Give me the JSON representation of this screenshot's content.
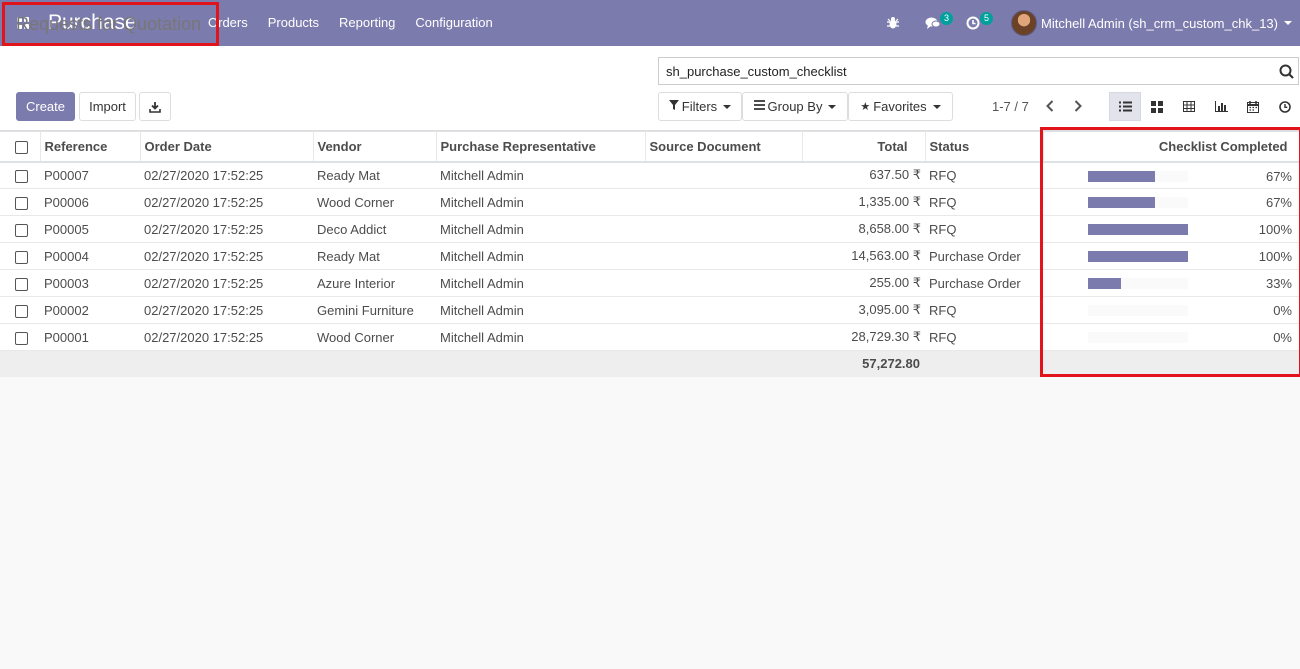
{
  "app": {
    "title": "Purchase"
  },
  "menu": [
    "Orders",
    "Products",
    "Reporting",
    "Configuration"
  ],
  "nav": {
    "messages_count": "3",
    "activities_count": "5",
    "user_name": "Mitchell Admin (sh_crm_custom_chk_13)"
  },
  "page": {
    "title": "Requests for Quotation"
  },
  "buttons": {
    "create": "Create",
    "import": "Import"
  },
  "search": {
    "value": "sh_purchase_custom_checklist"
  },
  "filters": {
    "filters": "Filters",
    "group_by": "Group By",
    "favorites": "Favorites"
  },
  "pager": {
    "text": "1-7 / 7"
  },
  "table": {
    "columns": [
      "Reference",
      "Order Date",
      "Vendor",
      "Purchase Representative",
      "Source Document",
      "Total",
      "Status",
      "Checklist Completed"
    ],
    "rows": [
      {
        "reference": "P00007",
        "order_date": "02/27/2020 17:52:25",
        "vendor": "Ready Mat",
        "rep": "Mitchell Admin",
        "source": "",
        "total": "637.50 ₹",
        "status": "RFQ",
        "checklist": 67,
        "checklist_label": "67%"
      },
      {
        "reference": "P00006",
        "order_date": "02/27/2020 17:52:25",
        "vendor": "Wood Corner",
        "rep": "Mitchell Admin",
        "source": "",
        "total": "1,335.00 ₹",
        "status": "RFQ",
        "checklist": 67,
        "checklist_label": "67%"
      },
      {
        "reference": "P00005",
        "order_date": "02/27/2020 17:52:25",
        "vendor": "Deco Addict",
        "rep": "Mitchell Admin",
        "source": "",
        "total": "8,658.00 ₹",
        "status": "RFQ",
        "checklist": 100,
        "checklist_label": "100%"
      },
      {
        "reference": "P00004",
        "order_date": "02/27/2020 17:52:25",
        "vendor": "Ready Mat",
        "rep": "Mitchell Admin",
        "source": "",
        "total": "14,563.00 ₹",
        "status": "Purchase Order",
        "checklist": 100,
        "checklist_label": "100%"
      },
      {
        "reference": "P00003",
        "order_date": "02/27/2020 17:52:25",
        "vendor": "Azure Interior",
        "rep": "Mitchell Admin",
        "source": "",
        "total": "255.00 ₹",
        "status": "Purchase Order",
        "checklist": 33,
        "checklist_label": "33%"
      },
      {
        "reference": "P00002",
        "order_date": "02/27/2020 17:52:25",
        "vendor": "Gemini Furniture",
        "rep": "Mitchell Admin",
        "source": "",
        "total": "3,095.00 ₹",
        "status": "RFQ",
        "checklist": 0,
        "checklist_label": "0%"
      },
      {
        "reference": "P00001",
        "order_date": "02/27/2020 17:52:25",
        "vendor": "Wood Corner",
        "rep": "Mitchell Admin",
        "source": "",
        "total": "28,729.30 ₹",
        "status": "RFQ",
        "checklist": 0,
        "checklist_label": "0%"
      }
    ],
    "total_sum": "57,272.80"
  },
  "colors": {
    "brand": "#7c7bad",
    "highlight": "#e0141a",
    "badge": "#00a09d"
  }
}
